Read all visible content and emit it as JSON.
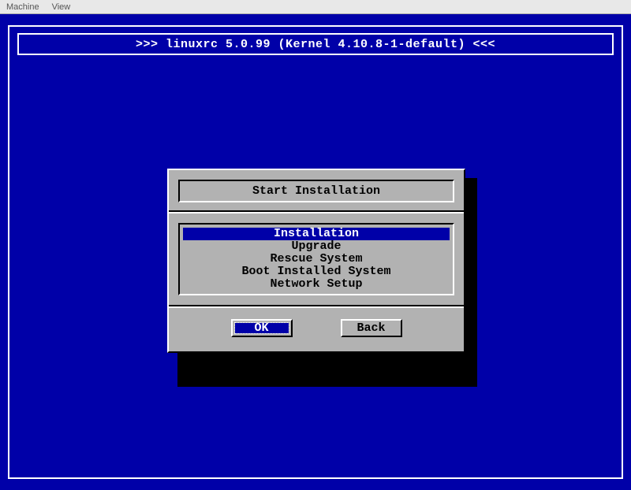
{
  "menubar": {
    "machine": "Machine",
    "view": "View"
  },
  "header": {
    "text": ">>> linuxrc 5.0.99 (Kernel 4.10.8-1-default) <<<"
  },
  "dialog": {
    "title": "Start Installation",
    "menu": [
      {
        "label": "Installation",
        "selected": true
      },
      {
        "label": "Upgrade",
        "selected": false
      },
      {
        "label": "Rescue System",
        "selected": false
      },
      {
        "label": "Boot Installed System",
        "selected": false
      },
      {
        "label": "Network Setup",
        "selected": false
      }
    ],
    "buttons": {
      "ok": "OK",
      "back": "Back"
    }
  }
}
